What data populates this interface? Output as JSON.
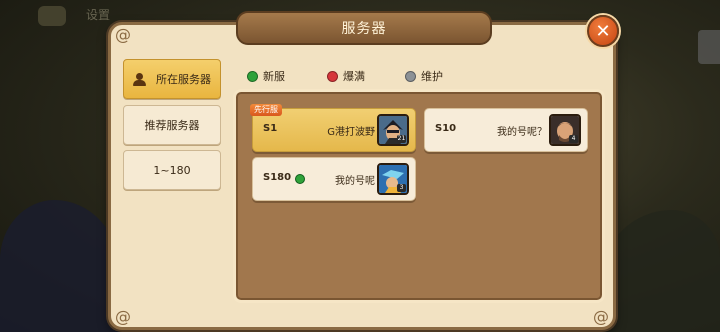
{
  "dialog": {
    "title": "服务器"
  },
  "background": {
    "top_text": "设置"
  },
  "sidebar": {
    "tabs": [
      {
        "label": "所在服务器",
        "active": true
      },
      {
        "label": "推荐服务器",
        "active": false
      },
      {
        "label": "1~180",
        "active": false
      }
    ]
  },
  "legend": [
    {
      "label": "新服",
      "color": "#2fa23a"
    },
    {
      "label": "爆满",
      "color": "#d6363a"
    },
    {
      "label": "维护",
      "color": "#8c9196"
    }
  ],
  "servers": [
    {
      "id": "S1",
      "name": "G港打波野",
      "tag": "先行服",
      "level": "21",
      "selected": true
    },
    {
      "id": "S10",
      "name": "我的号呢？",
      "level": "4",
      "selected": false
    },
    {
      "id": "S180",
      "name": "我的号呢",
      "level": "3",
      "status_color": "#2fa23a",
      "selected": false
    }
  ],
  "colors": {
    "accent": "#e9b53f",
    "panel": "#a1774d",
    "close": "#d9581d"
  },
  "icons": {
    "close": "close-icon",
    "person": "person-icon"
  }
}
